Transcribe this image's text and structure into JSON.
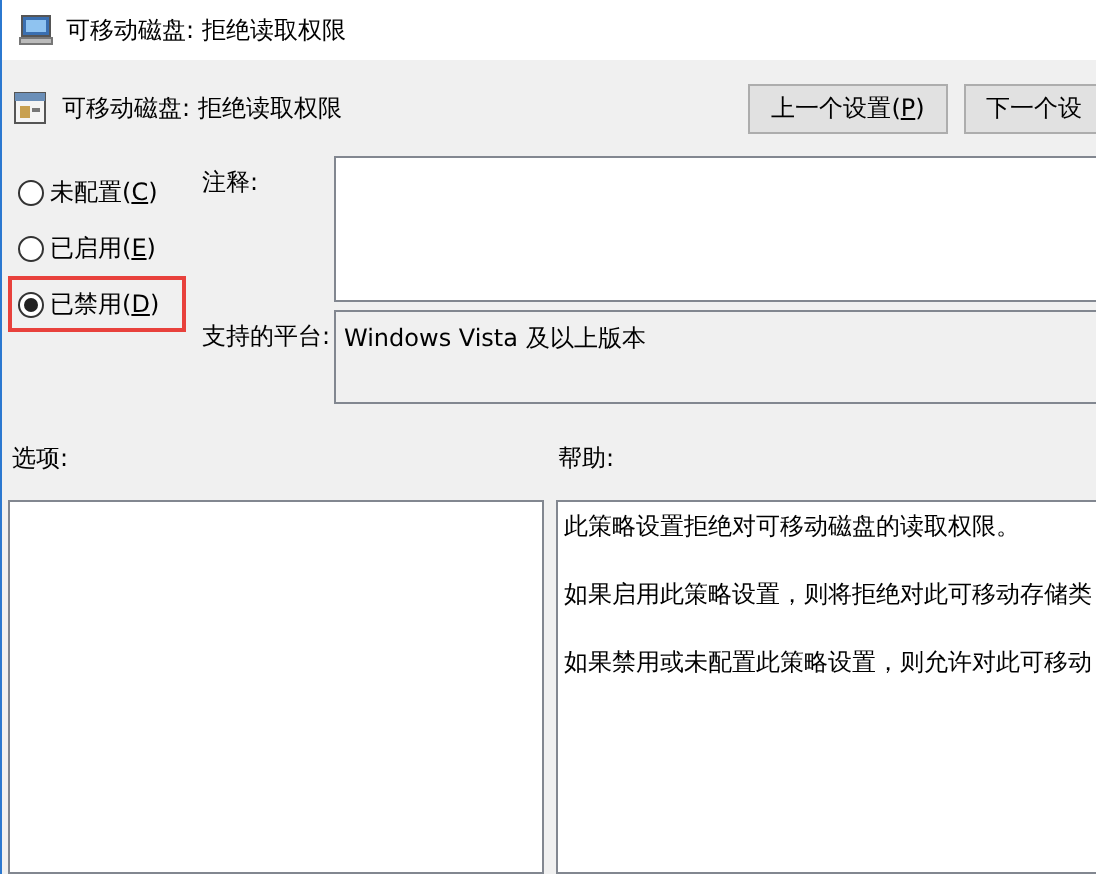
{
  "window": {
    "title": "可移动磁盘: 拒绝读取权限"
  },
  "header": {
    "title": "可移动磁盘: 拒绝读取权限",
    "buttons": [
      {
        "label": "上一个设置(",
        "access_key": "P",
        "label_end": ")"
      },
      {
        "label": "下一个设"
      }
    ]
  },
  "state_options": [
    {
      "label": "未配置(",
      "access_key": "C",
      "label_end": ")",
      "selected": false,
      "highlighted": false
    },
    {
      "label": "已启用(",
      "access_key": "E",
      "label_end": ")",
      "selected": false,
      "highlighted": false
    },
    {
      "label": "已禁用(",
      "access_key": "D",
      "label_end": ")",
      "selected": true,
      "highlighted": true
    }
  ],
  "comment": {
    "label": "注释:"
  },
  "supported_on": {
    "label": "支持的平台:",
    "value": "Windows Vista 及以上版本"
  },
  "options": {
    "label": "选项:"
  },
  "help": {
    "label": "帮助:",
    "paragraphs": [
      "此策略设置拒绝对可移动磁盘的读取权限。",
      "如果启用此策略设置，则将拒绝对此可移动存储类",
      "如果禁用或未配置此策略设置，则允许对此可移动"
    ]
  }
}
